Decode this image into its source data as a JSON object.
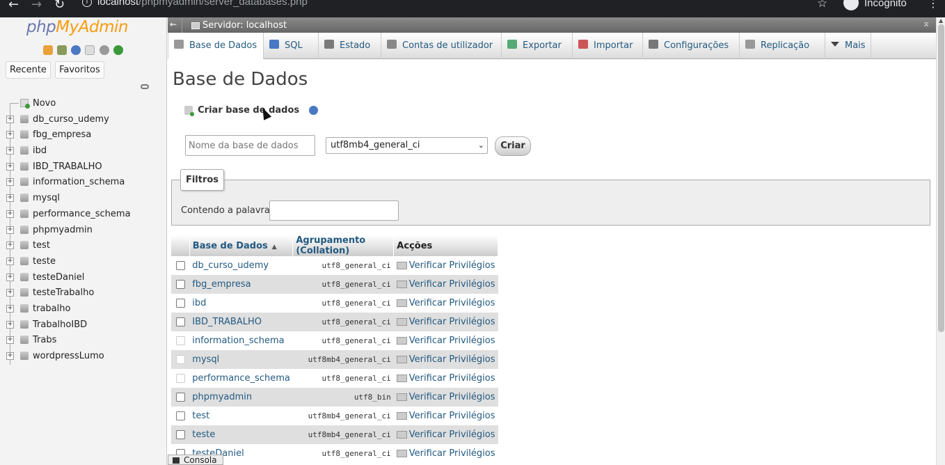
{
  "browser": {
    "back": "←",
    "forward": "→",
    "reload": "↻",
    "url_host": "localhost",
    "url_path": "/phpmyadmin/server_databases.php",
    "star": "☆",
    "incognito_label": "Incognito",
    "menu": "⋮"
  },
  "nav": {
    "logo_php": "php",
    "logo_myadmin": "MyAdmin",
    "recent_label": "Recente",
    "favorites_label": "Favoritos",
    "tree": [
      {
        "label": "Novo",
        "type": "new"
      },
      {
        "label": "db_curso_udemy",
        "type": "db"
      },
      {
        "label": "fbg_empresa",
        "type": "db"
      },
      {
        "label": "ibd",
        "type": "db"
      },
      {
        "label": "IBD_TRABALHO",
        "type": "db"
      },
      {
        "label": "information_schema",
        "type": "db"
      },
      {
        "label": "mysql",
        "type": "db"
      },
      {
        "label": "performance_schema",
        "type": "db"
      },
      {
        "label": "phpmyadmin",
        "type": "db"
      },
      {
        "label": "test",
        "type": "db"
      },
      {
        "label": "teste",
        "type": "db"
      },
      {
        "label": "testeDaniel",
        "type": "db"
      },
      {
        "label": "testeTrabalho",
        "type": "db"
      },
      {
        "label": "trabalho",
        "type": "db"
      },
      {
        "label": "TrabalhoIBD",
        "type": "db"
      },
      {
        "label": "Trabs",
        "type": "db"
      },
      {
        "label": "wordpressLumo",
        "type": "db"
      }
    ]
  },
  "server_bar": {
    "label": "Servidor: localhost"
  },
  "topmenu": {
    "tabs": [
      {
        "label": "Base de Dados",
        "icon": "database-icon",
        "active": true
      },
      {
        "label": "SQL",
        "icon": "sql-icon"
      },
      {
        "label": "Estado",
        "icon": "status-icon"
      },
      {
        "label": "Contas de utilizador",
        "icon": "users-icon"
      },
      {
        "label": "Exportar",
        "icon": "export-icon"
      },
      {
        "label": "Importar",
        "icon": "import-icon"
      },
      {
        "label": "Configurações",
        "icon": "wrench-icon"
      },
      {
        "label": "Replicação",
        "icon": "replication-icon"
      },
      {
        "label": "Mais",
        "icon": "chevron-down-icon"
      }
    ]
  },
  "page": {
    "title": "Base de Dados",
    "create_label": "Criar base de dados",
    "db_name_placeholder": "Nome da base de dados",
    "collation_value": "utf8mb4_general_ci",
    "create_button": "Criar",
    "filters_legend": "Filtros",
    "filter_label": "Contendo a palavra:",
    "filter_value": ""
  },
  "table": {
    "headers": {
      "name": "Base de Dados",
      "sort": "▲",
      "collation": "Agrupamento (Collation)",
      "actions": "Acções"
    },
    "action_label": "Verificar Privilégios",
    "rows": [
      {
        "name": "db_curso_udemy",
        "collation": "utf8_general_ci",
        "checkbox_enabled": true
      },
      {
        "name": "fbg_empresa",
        "collation": "utf8_general_ci",
        "checkbox_enabled": true
      },
      {
        "name": "ibd",
        "collation": "utf8_general_ci",
        "checkbox_enabled": true
      },
      {
        "name": "IBD_TRABALHO",
        "collation": "utf8_general_ci",
        "checkbox_enabled": true
      },
      {
        "name": "information_schema",
        "collation": "utf8_general_ci",
        "checkbox_enabled": false
      },
      {
        "name": "mysql",
        "collation": "utf8mb4_general_ci",
        "checkbox_enabled": false
      },
      {
        "name": "performance_schema",
        "collation": "utf8_general_ci",
        "checkbox_enabled": false
      },
      {
        "name": "phpmyadmin",
        "collation": "utf8_bin",
        "checkbox_enabled": true
      },
      {
        "name": "test",
        "collation": "utf8mb4_general_ci",
        "checkbox_enabled": true
      },
      {
        "name": "teste",
        "collation": "utf8mb4_general_ci",
        "checkbox_enabled": true
      },
      {
        "name": "testeDaniel",
        "collation": "utf8_general_ci",
        "checkbox_enabled": true
      }
    ]
  },
  "console": {
    "label": "Consola"
  }
}
